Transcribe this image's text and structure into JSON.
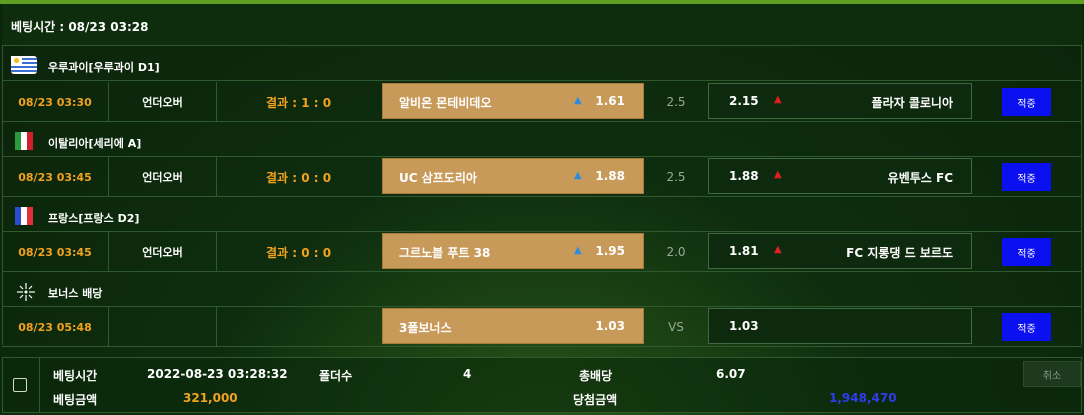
{
  "header": {
    "title": "베팅시간 : 08/23 03:28"
  },
  "sections": [
    {
      "league": {
        "name": "우루과이[우루과이 D1]",
        "flag_icon": "uruguay-flag-icon"
      },
      "match": {
        "time": "08/23 03:30",
        "type": "언더오버",
        "result": "결과 : 1 : 0",
        "home_name": "알비온 몬테비데오",
        "home_arrow": "▲",
        "home_odd": "1.61",
        "handicap": "2.5",
        "away_odd": "2.15",
        "away_arrow": "▲",
        "away_name": "플라자 콜로니아",
        "bet_label": "적중"
      }
    },
    {
      "league": {
        "name": "이탈리아[세리에 A]",
        "flag_icon": "italy-flag-icon"
      },
      "match": {
        "time": "08/23 03:45",
        "type": "언더오버",
        "result": "결과 : 0 : 0",
        "home_name": "UC 삼프도리아",
        "home_arrow": "▲",
        "home_odd": "1.88",
        "handicap": "2.5",
        "away_odd": "1.88",
        "away_arrow": "▲",
        "away_name": "유벤투스 FC",
        "bet_label": "적중"
      }
    },
    {
      "league": {
        "name": "프랑스[프랑스 D2]",
        "flag_icon": "france-flag-icon"
      },
      "match": {
        "time": "08/23 03:45",
        "type": "언더오버",
        "result": "결과 : 0 : 0",
        "home_name": "그르노블 푸트 38",
        "home_arrow": "▲",
        "home_odd": "1.95",
        "handicap": "2.0",
        "away_odd": "1.81",
        "away_arrow": "▲",
        "away_name": "FC 지롱댕 드 보르도",
        "bet_label": "적중"
      }
    },
    {
      "league": {
        "name": "보너스 배당",
        "flag_icon": "bonus-sparkle-icon"
      },
      "match": {
        "time": "08/23 05:48",
        "type": "",
        "result": "",
        "home_name": "3폴보너스",
        "home_arrow": "",
        "home_odd": "1.03",
        "handicap": "VS",
        "away_odd": "1.03",
        "away_arrow": "",
        "away_name": "",
        "bet_label": "적중"
      }
    }
  ],
  "slip": {
    "bet_time_label": "베팅시간",
    "bet_time_value": "2022-08-23 03:28:32",
    "folder_label": "폴더수",
    "folder_value": "4",
    "total_odds_label": "총배당",
    "total_odds_value": "6.07",
    "bet_amount_label": "베팅금액",
    "bet_amount_value": "321,000",
    "win_amount_label": "당첨금액",
    "win_amount_value": "1,948,470",
    "cancel_label": "취소"
  },
  "colors": {
    "accent_orange": "#f2a21e",
    "home_bg": "#c89a5a",
    "bet_button": "#0a10f0",
    "win_amount": "#2f3cf0",
    "arrow_up_blue": "#2b8de0",
    "arrow_up_red": "#e02020"
  }
}
